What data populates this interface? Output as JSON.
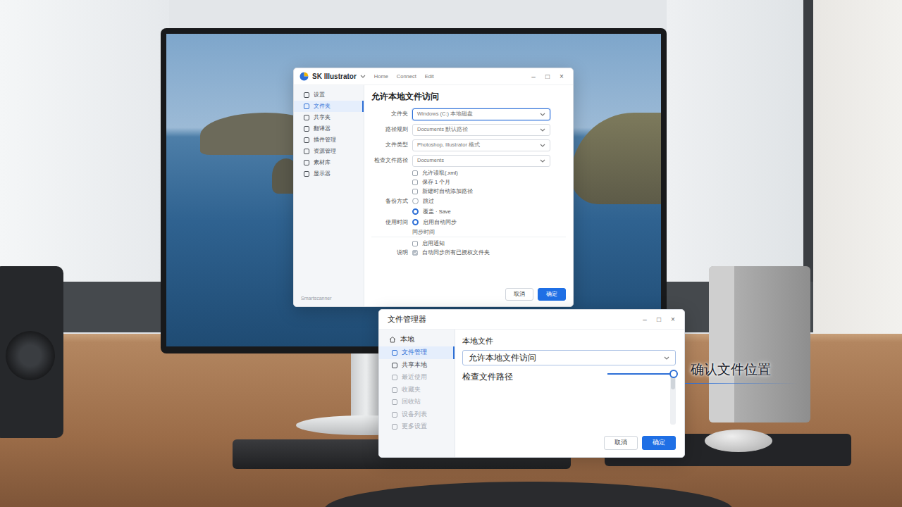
{
  "app_window": {
    "title": "SK Illustrator",
    "title_menu": [
      "Home",
      "Connect",
      "Edit"
    ],
    "controls": [
      "–",
      "□",
      "×"
    ],
    "sidebar": {
      "items": [
        {
          "label": "设置",
          "selected": false
        },
        {
          "label": "文件夹",
          "selected": true
        },
        {
          "label": "共享夹",
          "selected": false
        },
        {
          "label": "翻译器",
          "selected": false
        },
        {
          "label": "插件管理",
          "selected": false
        },
        {
          "label": "资源管理",
          "selected": false
        },
        {
          "label": "素材库",
          "selected": false
        },
        {
          "label": "显示器",
          "selected": false
        }
      ],
      "footer": "Smartscanner"
    },
    "heading": "允许本地文件访问",
    "rows": [
      {
        "kind": "select",
        "label": "文件夹",
        "value": "Windows (C:) 本地磁盘",
        "focused": true
      },
      {
        "kind": "select",
        "label": "路径规则",
        "value": "Documents 默认路径",
        "focused": false
      },
      {
        "kind": "select",
        "label": "文件类型",
        "value": "Photoshop, Illustrator 格式",
        "focused": false
      },
      {
        "kind": "select",
        "label": "检查文件路径",
        "value": "Documents",
        "focused": false
      },
      {
        "kind": "check",
        "text": "允许读取(.xml)",
        "checked": false
      },
      {
        "kind": "check",
        "text": "保存 1 个月",
        "checked": false
      },
      {
        "kind": "check",
        "text": "新建时自动添加路径",
        "checked": false
      },
      {
        "kind": "radio",
        "label": "备份方式",
        "text": "跳过",
        "selected": false
      },
      {
        "kind": "radio",
        "text": "覆盖 · Save",
        "selected": true
      },
      {
        "kind": "radio",
        "label": "使用时间",
        "text": "启用自动同步",
        "selected": true
      },
      {
        "kind": "note",
        "text": "同步时间"
      },
      {
        "kind": "check",
        "text": "启用通知",
        "checked": false
      },
      {
        "kind": "check",
        "label": "说明",
        "text": "自动同步所有已授权文件夹",
        "checked": true
      }
    ],
    "buttons": [
      {
        "label": "取消",
        "primary": false
      },
      {
        "label": "确定",
        "primary": true
      }
    ]
  },
  "file_window": {
    "title": "文件管理器",
    "controls": [
      "–",
      "□",
      "×"
    ],
    "sidebar": {
      "header": "本地",
      "items": [
        {
          "label": "文件管理",
          "selected": true,
          "disabled": false
        },
        {
          "label": "共享本地",
          "selected": false,
          "disabled": false
        },
        {
          "label": "最近使用",
          "selected": false,
          "disabled": true
        },
        {
          "label": "收藏夹",
          "selected": false,
          "disabled": true
        },
        {
          "label": "回收站",
          "selected": false,
          "disabled": true
        },
        {
          "label": "设备列表",
          "selected": false,
          "disabled": true
        },
        {
          "label": "更多设置",
          "selected": false,
          "disabled": true
        }
      ]
    },
    "heading": "本地文件",
    "select": "允许本地文件访问",
    "path_label": "检查文件路径",
    "buttons": [
      {
        "label": "取消",
        "primary": false
      },
      {
        "label": "确定",
        "primary": true
      }
    ]
  },
  "callout": {
    "text": "确认文件位置"
  }
}
